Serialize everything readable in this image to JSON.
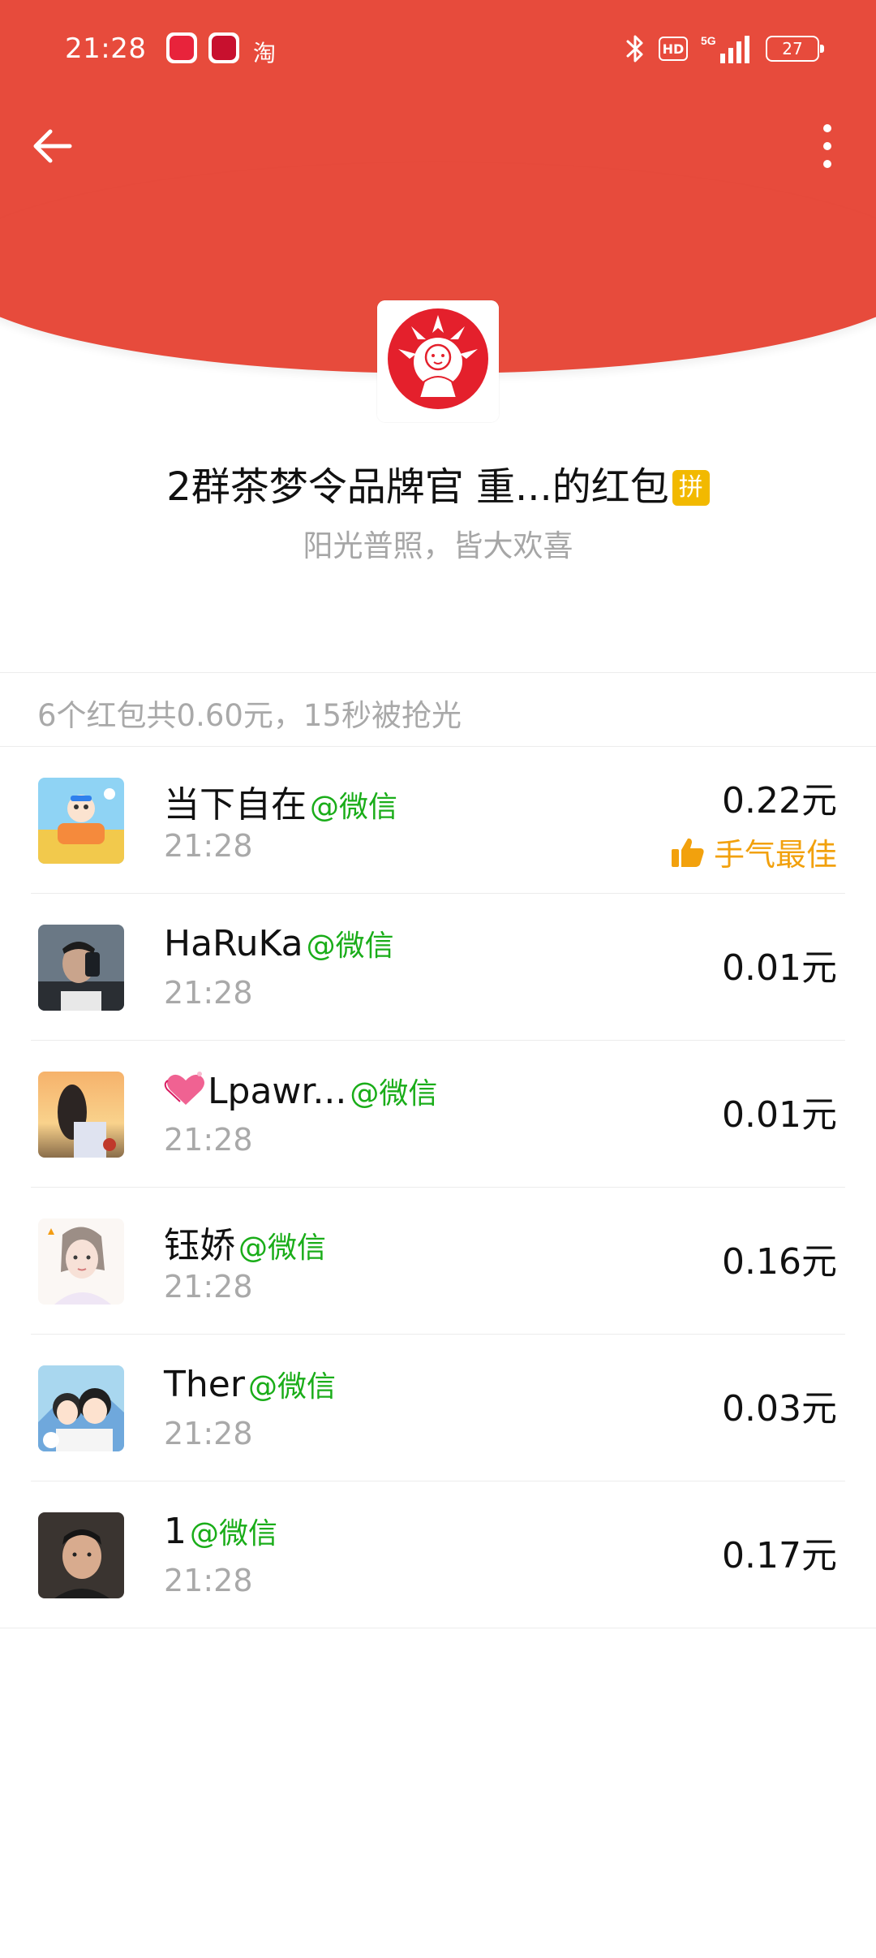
{
  "status_bar": {
    "time": "21:28",
    "taobao_label": "淘",
    "hd_label": "HD",
    "battery": "27",
    "network": "5G"
  },
  "sender": {
    "title": "2群茶梦令品牌官 重...的红包",
    "badge": "拼",
    "subtitle": "阳光普照，皆大欢喜"
  },
  "summary": "6个红包共0.60元，15秒被抢光",
  "source_label": "@微信",
  "best_label": "手气最佳",
  "receivers": [
    {
      "name": "当下自在",
      "time": "21:28",
      "amount": "0.22元",
      "best": true
    },
    {
      "name": "HaRuKa",
      "time": "21:28",
      "amount": "0.01元",
      "best": false
    },
    {
      "name": "Lpawr...",
      "time": "21:28",
      "amount": "0.01元",
      "best": false
    },
    {
      "name": "钰娇",
      "time": "21:28",
      "amount": "0.16元",
      "best": false
    },
    {
      "name": "Ther",
      "time": "21:28",
      "amount": "0.03元",
      "best": false
    },
    {
      "name": "1",
      "time": "21:28",
      "amount": "0.17元",
      "best": false
    }
  ],
  "icons": {
    "back": "back-arrow-icon",
    "more": "more-vertical-icon",
    "best": "thumbs-up-icon"
  },
  "colors": {
    "accent": "#e74b3c",
    "source_green": "#1aad19",
    "best_gold": "#f2a10d"
  }
}
